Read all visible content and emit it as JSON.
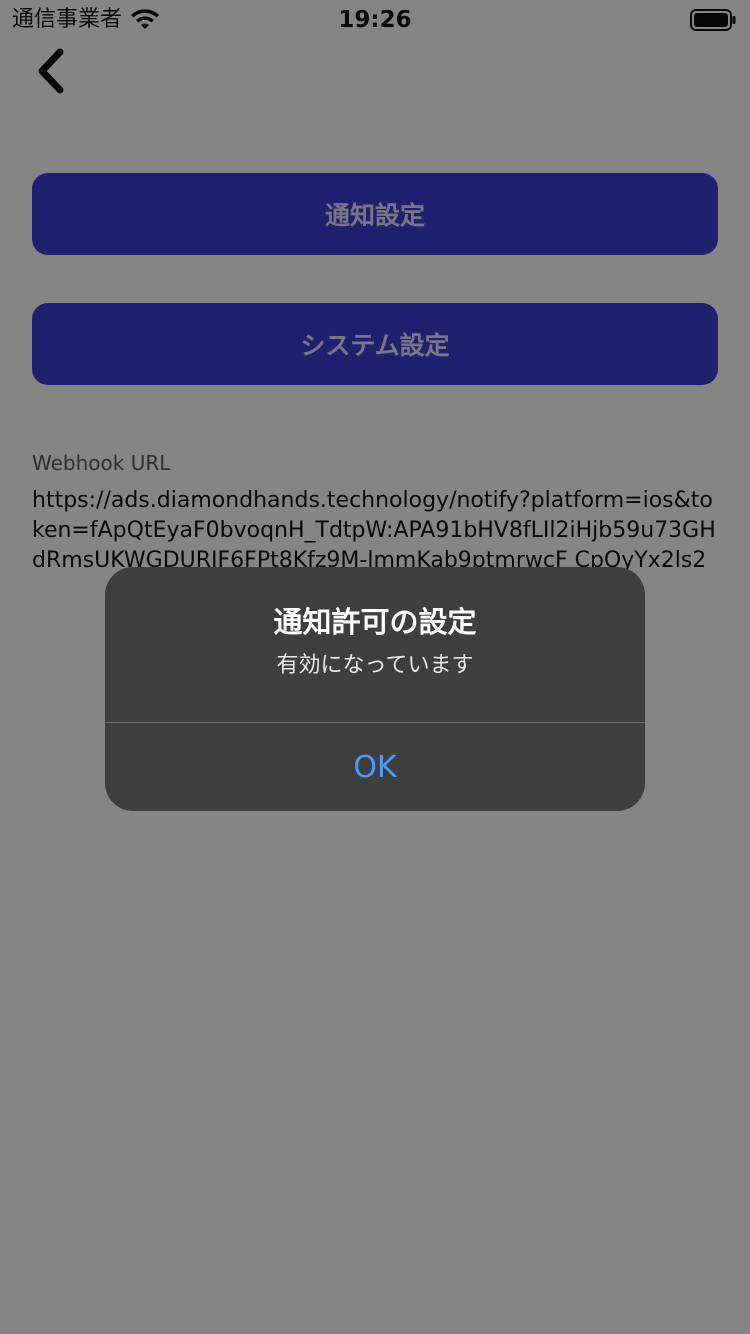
{
  "status_bar": {
    "carrier": "通信事業者",
    "time": "19:26",
    "wifi_icon": "wifi-icon",
    "battery_icon": "battery-icon"
  },
  "nav": {
    "back_icon": "chevron-left-icon"
  },
  "buttons": {
    "notification_settings": "通知設定",
    "system_settings": "システム設定"
  },
  "webhook": {
    "label": "Webhook URL",
    "url": "https://ads.diamondhands.technology/notify?platform=ios&token=fApQtEyaF0bvoqnH_TdtpW:APA91bHV8fLIl2iHjb59u73GHdRmsUKWGDURIF6FPt8Kfz9M-lmmKab9ptmrwcF  CpQyYx2ls2"
  },
  "alert": {
    "title": "通知許可の設定",
    "message": "有効になっています",
    "ok_label": "OK"
  },
  "colors": {
    "button_bg": "#3f3fd6",
    "alert_bg": "#3e3e3e",
    "alert_action": "#4a9cff"
  }
}
